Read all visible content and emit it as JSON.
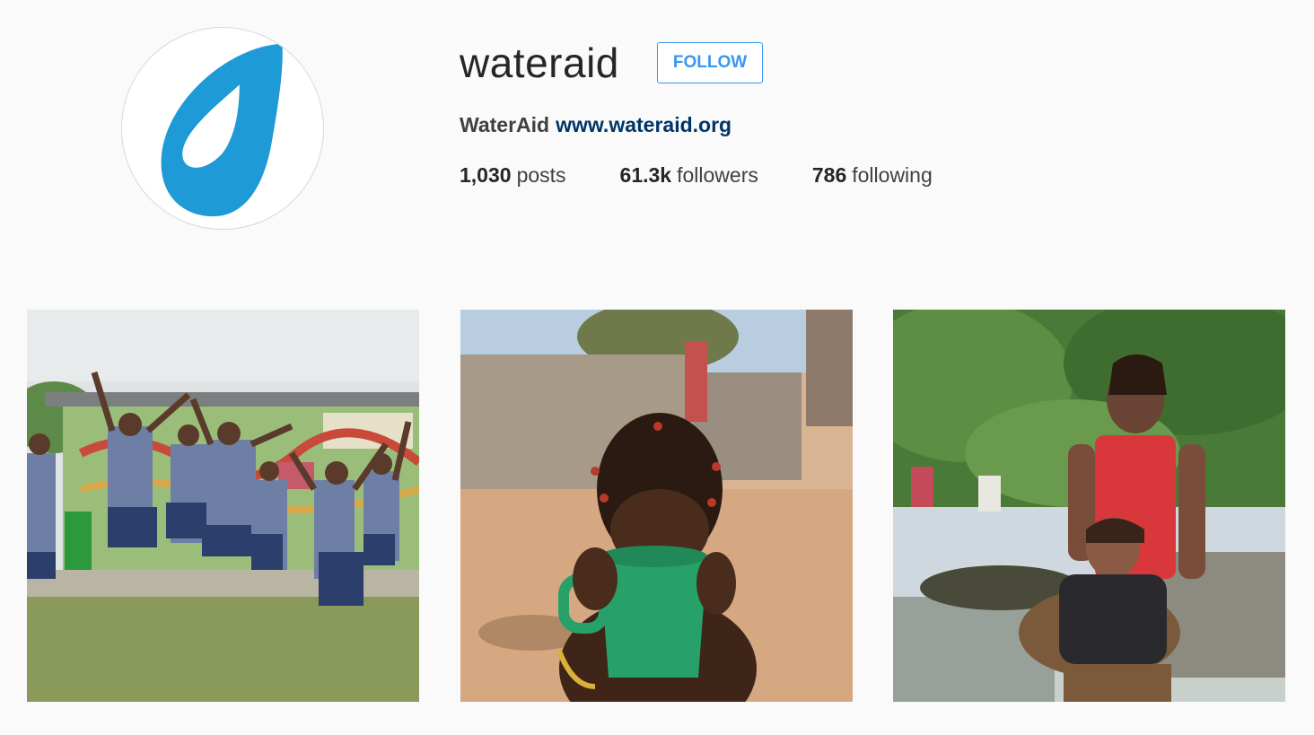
{
  "profile": {
    "username": "wateraid",
    "follow_label": "FOLLOW",
    "full_name": "WaterAid",
    "website": "www.wateraid.org",
    "avatar_icon": "water-drop-logo-icon",
    "avatar_color": "#1e9ad6"
  },
  "stats": {
    "posts_count": "1,030",
    "posts_label": "posts",
    "followers_count": "61.3k",
    "followers_label": "followers",
    "following_count": "786",
    "following_label": "following"
  },
  "colors": {
    "background": "#fafafa",
    "follow_blue": "#3897f0",
    "link_navy": "#003569"
  },
  "posts": [
    {
      "description": "schoolgirls-jumping-photo"
    },
    {
      "description": "child-drinking-from-green-cup-photo"
    },
    {
      "description": "mother-and-child-by-water-photo"
    }
  ]
}
